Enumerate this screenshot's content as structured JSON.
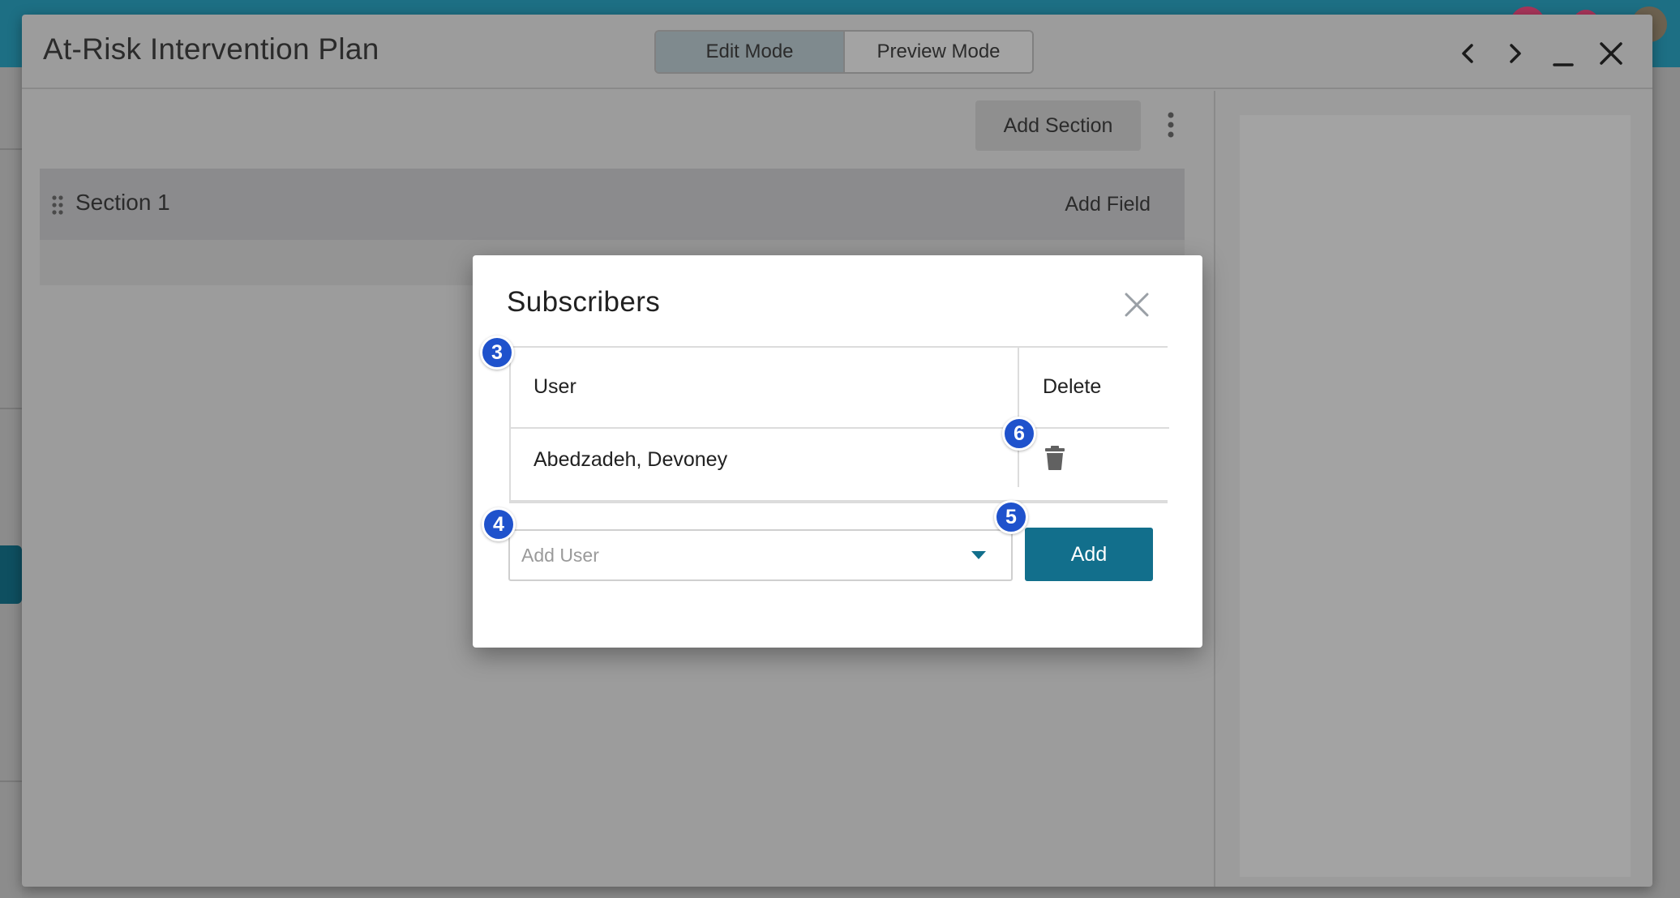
{
  "window": {
    "title": "At-Risk Intervention Plan",
    "modes": [
      "Edit Mode",
      "Preview Mode"
    ],
    "active_mode": "Edit Mode"
  },
  "toolbar": {
    "add_section_label": "Add Section"
  },
  "section": {
    "title": "Section 1",
    "add_field_label": "Add Field"
  },
  "modal": {
    "title": "Subscribers",
    "columns": {
      "user": "User",
      "delete": "Delete"
    },
    "rows": [
      {
        "user": "Abedzadeh, Devoney"
      }
    ],
    "add_user_placeholder": "Add User",
    "add_button_label": "Add"
  },
  "badges": {
    "table": "3",
    "add_user": "4",
    "add_button": "5",
    "delete": "6"
  },
  "icons": {
    "prev": "chevron-left-icon",
    "next": "chevron-right-icon",
    "minimize": "minimize-icon",
    "close": "close-icon",
    "more": "more-vertical-icon",
    "drag": "drag-handle-icon",
    "trash": "trash-icon",
    "dropdown": "caret-down-icon"
  },
  "colors": {
    "topbar": "#1d6f84",
    "primary_button": "#126f8c",
    "badge": "#1f52cc",
    "overlay": "#9c9c9c",
    "avatar_pink": "#d94a7a"
  }
}
